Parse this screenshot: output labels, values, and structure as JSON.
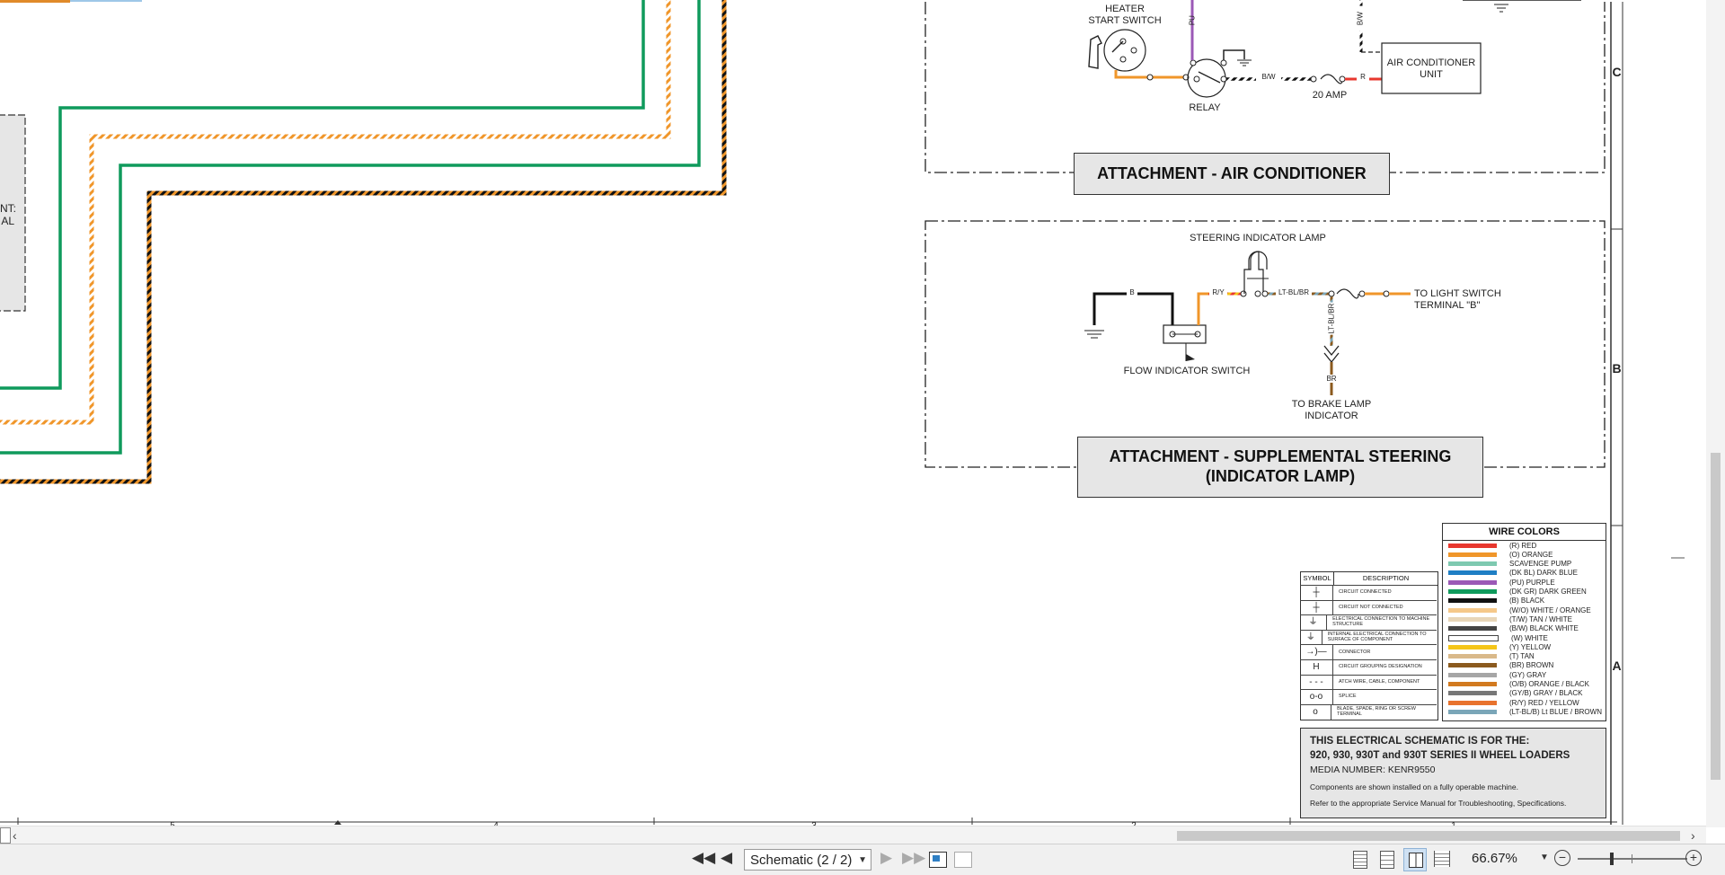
{
  "schematic": {
    "ac_section": {
      "heater_start_switch": "HEATER\nSTART SWITCH",
      "relay": "RELAY",
      "wire_pu": "PU",
      "wire_bw": "B/W",
      "wire_bw_vertical": "B/W",
      "wire_r": "R",
      "fuse": "20 AMP",
      "ac_unit": "AIR CONDITIONER\nUNIT",
      "title": "ATTACHMENT - AIR CONDITIONER",
      "zone": "C"
    },
    "steering_section": {
      "lamp": "STEERING INDICATOR LAMP",
      "wire_b": "B",
      "wire_ry": "R/Y",
      "wire_ltblbr": "LT-BL/BR",
      "wire_ltblbr_vertical": "LT-BL/BR",
      "wire_br": "BR",
      "to_light_switch": "TO LIGHT SWITCH\nTERMINAL \"B\"",
      "flow_switch": "FLOW INDICATOR SWITCH",
      "to_brake_lamp": "TO BRAKE LAMP\nINDICATOR",
      "title": "ATTACHMENT - SUPPLEMENTAL STEERING\n(INDICATOR LAMP)",
      "zone": "B"
    },
    "left_box_text": "NT:\nAL",
    "zone_a": "A",
    "bottom_ruler": [
      "5",
      "4",
      "3",
      "2",
      "1"
    ]
  },
  "wire_colors": {
    "title": "WIRE COLORS",
    "items": [
      {
        "label": "(R) RED",
        "color": "#e8372e"
      },
      {
        "label": "(O) ORANGE",
        "color": "#f0962a"
      },
      {
        "label": "SCAVENGE PUMP",
        "color": "#7ec9b0"
      },
      {
        "label": "(DK BL) DARK BLUE",
        "color": "#1f7fc4"
      },
      {
        "label": "(PU) PURPLE",
        "color": "#9b59b6"
      },
      {
        "label": "(DK GR) DARK GREEN",
        "color": "#0f9a5c"
      },
      {
        "label": "(B) BLACK",
        "color": "#111111"
      },
      {
        "label": "(W/O) WHITE / ORANGE",
        "color": "#f5c88a"
      },
      {
        "label": "(T/W) TAN / WHITE",
        "color": "#e8d6b8"
      },
      {
        "label": "(B/W) BLACK WHITE",
        "color": "#444444"
      },
      {
        "label": "(W) WHITE",
        "color": "#ffffff"
      },
      {
        "label": "(Y) YELLOW",
        "color": "#f5c518"
      },
      {
        "label": "(T) TAN",
        "color": "#d9b98a"
      },
      {
        "label": "(BR) BROWN",
        "color": "#8b5a1e"
      },
      {
        "label": "(GY) GRAY",
        "color": "#a6a6a6"
      },
      {
        "label": "(O/B) ORANGE / BLACK",
        "color": "#d27a1f"
      },
      {
        "label": "(GY/B) GRAY / BLACK",
        "color": "#777777"
      },
      {
        "label": "(R/Y) RED / YELLOW",
        "color": "#e8732e"
      },
      {
        "label": "(LT-BL/B) Lt BLUE / BROWN",
        "color": "#7aa6b8"
      }
    ]
  },
  "symbol_legend": {
    "col_symbol": "SYMBOL",
    "col_description": "DESCRIPTION",
    "items": [
      {
        "icon": "┼",
        "label": "CIRCUIT CONNECTED"
      },
      {
        "icon": "┼",
        "label": "CIRCUIT NOT CONNECTED"
      },
      {
        "icon": "⏚",
        "label": "ELECTRICAL CONNECTION TO MACHINE STRUCTURE"
      },
      {
        "icon": "⏚",
        "label": "INTERNAL ELECTRICAL CONNECTION TO SURFACE OF COMPONENT"
      },
      {
        "icon": "→)—",
        "label": "CONNECTOR"
      },
      {
        "icon": "H",
        "label": "CIRCUIT GROUPING DESIGNATION"
      },
      {
        "icon": "- - -",
        "label": "ATCH WIRE, CABLE, COMPONENT"
      },
      {
        "icon": "o-o",
        "label": "SPLICE"
      },
      {
        "icon": "o",
        "label": "BLADE, SPADE, RING OR SCREW TERMINAL"
      }
    ]
  },
  "info_box": {
    "line1": "THIS ELECTRICAL SCHEMATIC IS FOR THE:",
    "line2": "920, 930, 930T and 930T SERIES II WHEEL LOADERS",
    "line3": "MEDIA NUMBER: KENR9550",
    "line4": "Components are shown installed on a fully operable machine.",
    "line5": "Refer to the appropriate Service Manual for Troubleshooting, Specifications."
  },
  "statusbar": {
    "page_select": "Schematic (2 / 2)",
    "zoom": "66.67%"
  }
}
